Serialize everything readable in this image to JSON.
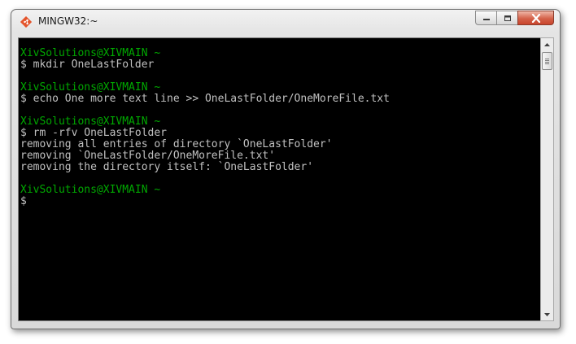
{
  "window": {
    "title": "MINGW32:~",
    "controls": {
      "minimize": "minimize-icon",
      "maximize": "maximize-icon",
      "close": "close-icon"
    }
  },
  "colors": {
    "prompt": "#00a800",
    "text": "#c0c0c0",
    "background": "#000000"
  },
  "terminal": {
    "lines": [
      {
        "kind": "prompt",
        "text": "XivSolutions@XIVMAIN ~"
      },
      {
        "kind": "command",
        "text": "$ mkdir OneLastFolder"
      },
      {
        "kind": "blank",
        "text": ""
      },
      {
        "kind": "prompt",
        "text": "XivSolutions@XIVMAIN ~"
      },
      {
        "kind": "command",
        "text": "$ echo One more text line >> OneLastFolder/OneMoreFile.txt"
      },
      {
        "kind": "blank",
        "text": ""
      },
      {
        "kind": "prompt",
        "text": "XivSolutions@XIVMAIN ~"
      },
      {
        "kind": "command",
        "text": "$ rm -rfv OneLastFolder"
      },
      {
        "kind": "output",
        "text": "removing all entries of directory `OneLastFolder'"
      },
      {
        "kind": "output",
        "text": "removing `OneLastFolder/OneMoreFile.txt'"
      },
      {
        "kind": "output",
        "text": "removing the directory itself: `OneLastFolder'"
      },
      {
        "kind": "blank",
        "text": ""
      },
      {
        "kind": "prompt",
        "text": "XivSolutions@XIVMAIN ~"
      },
      {
        "kind": "command",
        "text": "$"
      }
    ]
  },
  "scrollbar": {
    "icons": {
      "up": "chevron-up-icon",
      "down": "chevron-down-icon"
    }
  }
}
